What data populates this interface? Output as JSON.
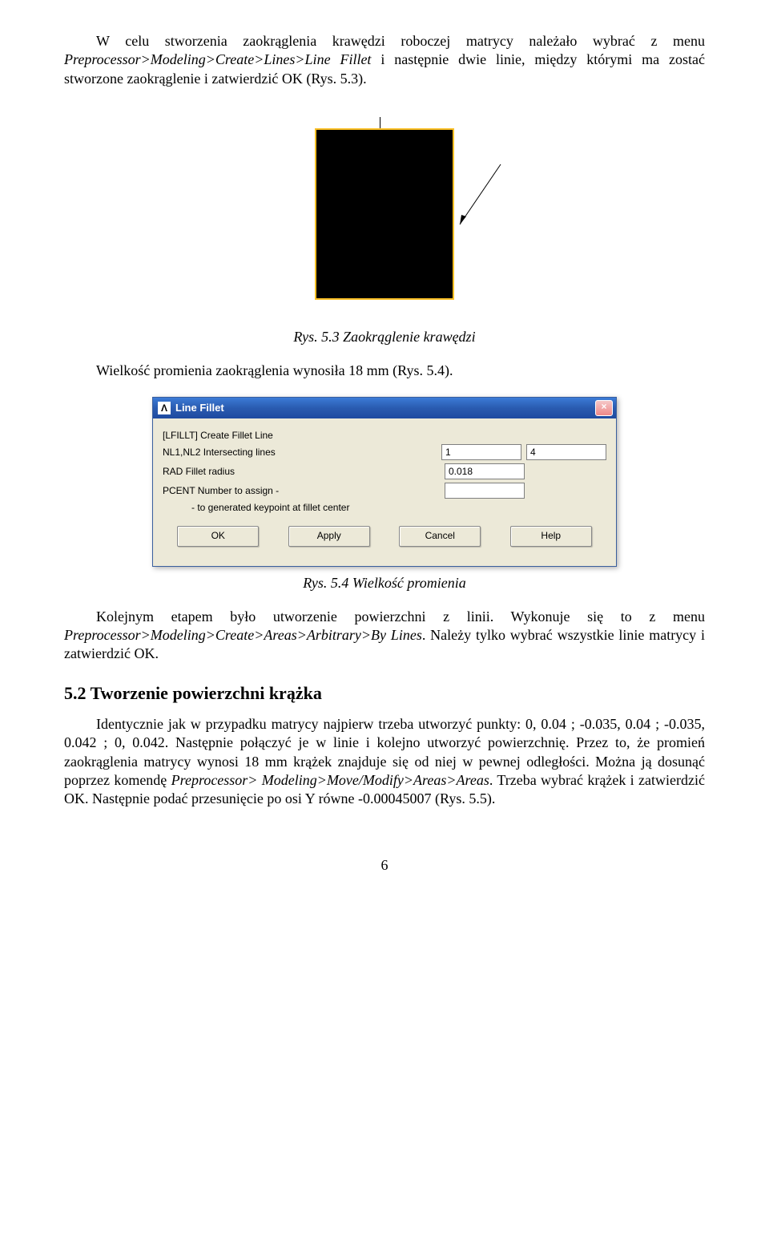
{
  "para1_pre": "W celu stworzenia zaokrąglenia krawędzi roboczej matrycy należało wybrać z menu ",
  "para1_menu": "Preprocessor>Modeling>Create>Lines>Line Fillet",
  "para1_post": " i następnie dwie linie, między którymi ma zostać stworzone zaokrąglenie i zatwierdzić OK (Rys. 5.3).",
  "caption53": "Rys. 5.3 Zaokrąglenie krawędzi",
  "para2": "Wielkość promienia zaokrąglenia wynosiła 18 mm (Rys. 5.4).",
  "dialog": {
    "title": "Line Fillet",
    "row_lfillt": "[LFILLT]  Create Fillet Line",
    "row_nl": "NL1,NL2  Intersecting lines",
    "nl1": "1",
    "nl2": "4",
    "row_rad": "RAD     Fillet radius",
    "rad": "0.018",
    "row_pcent": "PCENT   Number to assign -",
    "row_pcent2": "- to generated keypoint at fillet center",
    "btn_ok": "OK",
    "btn_apply": "Apply",
    "btn_cancel": "Cancel",
    "btn_help": "Help"
  },
  "caption54": "Rys. 5.4 Wielkość promienia",
  "para3_pre": "Kolejnym etapem było utworzenie powierzchni z linii. Wykonuje się to z menu ",
  "para3_menu": "Preprocessor>Modeling>Create>Areas>Arbitrary>By Lines",
  "para3_post": ". Należy tylko wybrać wszystkie linie matrycy i zatwierdzić OK.",
  "section52": "5.2  Tworzenie powierzchni krążka",
  "para4_pre": "Identycznie jak w przypadku matrycy najpierw trzeba utworzyć punkty: 0, 0.04 ; -0.035, 0.04 ; -0.035, 0.042 ; 0, 0.042. Następnie połączyć je w linie i kolejno utworzyć powierzchnię. Przez to, że promień zaokrąglenia matrycy wynosi 18 mm krążek znajduje się od niej w pewnej odległości. Można ją dosunąć poprzez komendę ",
  "para4_menu": "Preprocessor> Modeling>Move/Modify>Areas>Areas",
  "para4_post": ". Trzeba wybrać krążek i zatwierdzić OK. Następnie podać przesunięcie po osi Y równe -0.00045007 (Rys. 5.5).",
  "page_number": "6"
}
